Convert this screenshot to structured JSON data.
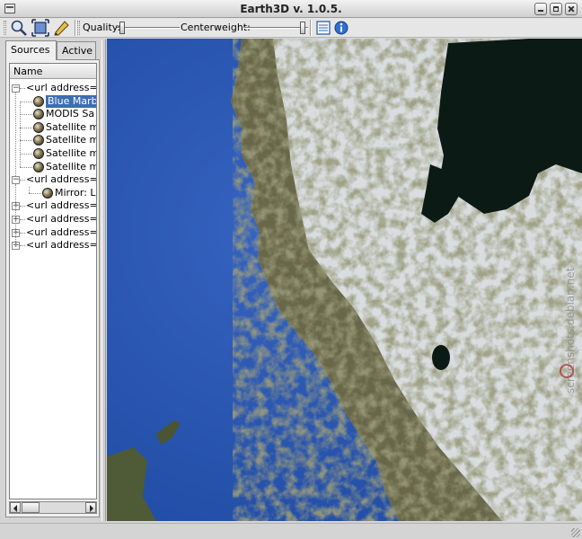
{
  "window": {
    "title": "Earth3D v. 1.0.5."
  },
  "toolbar": {
    "quality_label": "Quality:",
    "quality_level": 0.05,
    "centerweight_label": "Centerweight:",
    "centerweight_level": 0.95,
    "tools": [
      "zoom-icon",
      "fit-view-icon",
      "pencil-icon",
      "list-view-icon",
      "globe-info-icon"
    ]
  },
  "panel": {
    "tabs": [
      {
        "label": "Sources",
        "selected": true
      },
      {
        "label": "Active",
        "selected": false
      }
    ],
    "column_header": "Name",
    "tree": [
      {
        "text": "<url address=\"h",
        "level": 0,
        "expanded": true
      },
      {
        "text": "Blue Marb",
        "level": 1,
        "selected": true
      },
      {
        "text": "MODIS Sa",
        "level": 1
      },
      {
        "text": "Satellite m",
        "level": 1
      },
      {
        "text": "Satellite m",
        "level": 1
      },
      {
        "text": "Satellite m",
        "level": 1
      },
      {
        "text": "Satellite m",
        "level": 1
      },
      {
        "text": "<url address=\"h",
        "level": 0,
        "expanded": true
      },
      {
        "text": "Mirror: Lar",
        "level": 2
      },
      {
        "text": "<url address=\"h",
        "level": 0
      },
      {
        "text": "<url address=\"h",
        "level": 0
      },
      {
        "text": "<url address=\"h",
        "level": 0
      },
      {
        "text": "<url address=\"h",
        "level": 0
      }
    ]
  },
  "map": {
    "watermark": "screenshots.debian.net",
    "colors": {
      "ocean": "#2a55b0",
      "land": "#5a5a3a",
      "snow": "#dfe3e6",
      "lake": "#0d1a16"
    }
  }
}
